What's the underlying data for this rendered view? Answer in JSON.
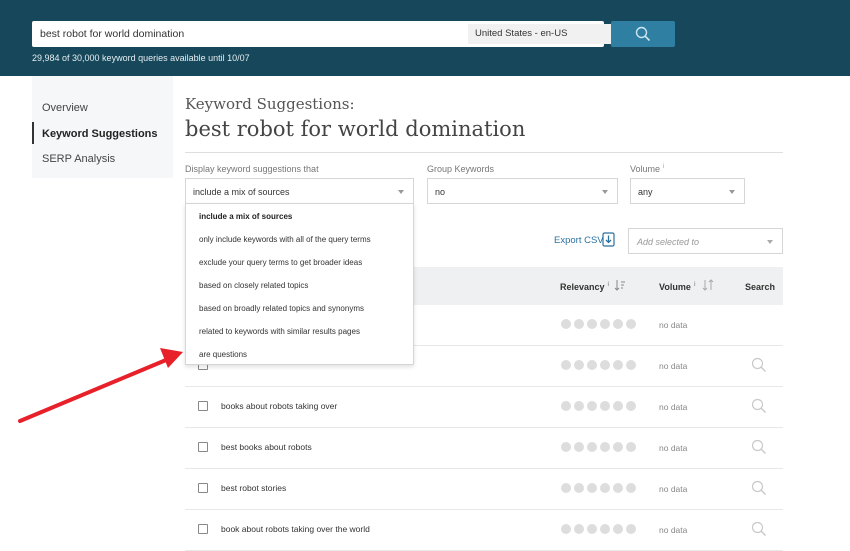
{
  "search": {
    "query": "best robot for world domination",
    "locale": "United States - en-US",
    "quota_text": "29,984 of 30,000 keyword queries available until 10/07"
  },
  "sidebar": {
    "items": [
      {
        "label": "Overview",
        "active": false
      },
      {
        "label": "Keyword Suggestions",
        "active": true
      },
      {
        "label": "SERP Analysis",
        "active": false
      }
    ]
  },
  "main": {
    "heading_label": "Keyword Suggestions:",
    "heading_query": "best robot for world domination"
  },
  "filters": {
    "display_label": "Display keyword suggestions that",
    "display_value": "include a mix of sources",
    "group_label": "Group Keywords",
    "group_value": "no",
    "volume_label": "Volume",
    "volume_value": "any",
    "info_mark": "i"
  },
  "display_menu": {
    "options": [
      "include a mix of sources",
      "only include keywords with all of the query terms",
      "exclude your query terms to get broader ideas",
      "based on closely related topics",
      "based on broadly related topics and synonyms",
      "related to keywords with similar results pages",
      "are questions"
    ],
    "selected_index": 0
  },
  "actions": {
    "export_label": "Export CSV",
    "add_selected_placeholder": "Add selected to"
  },
  "table": {
    "headers": {
      "relevancy": "Relevancy",
      "volume": "Volume",
      "search": "Search",
      "info_mark": "i"
    },
    "rows": [
      {
        "keyword": "",
        "volume": "no data",
        "relevancy": 0,
        "show_search": false
      },
      {
        "keyword": "",
        "volume": "no data",
        "relevancy": 0,
        "show_search": true
      },
      {
        "keyword": "books about robots taking over",
        "volume": "no data",
        "relevancy": 0,
        "show_search": true
      },
      {
        "keyword": "best books about robots",
        "volume": "no data",
        "relevancy": 0,
        "show_search": true
      },
      {
        "keyword": "best robot stories",
        "volume": "no data",
        "relevancy": 0,
        "show_search": true
      },
      {
        "keyword": "book about robots taking over the world",
        "volume": "no data",
        "relevancy": 0,
        "show_search": true
      }
    ]
  },
  "colors": {
    "topbar": "#16475a",
    "accent_button": "#2f7fa3",
    "annotation_arrow": "#e8202a",
    "link": "#2a72a0"
  },
  "icons": {
    "search_button": "search-icon",
    "export": "download-icon",
    "row_search": "search-icon",
    "sort": "sort-icon",
    "arrow": "annotation-arrow"
  }
}
